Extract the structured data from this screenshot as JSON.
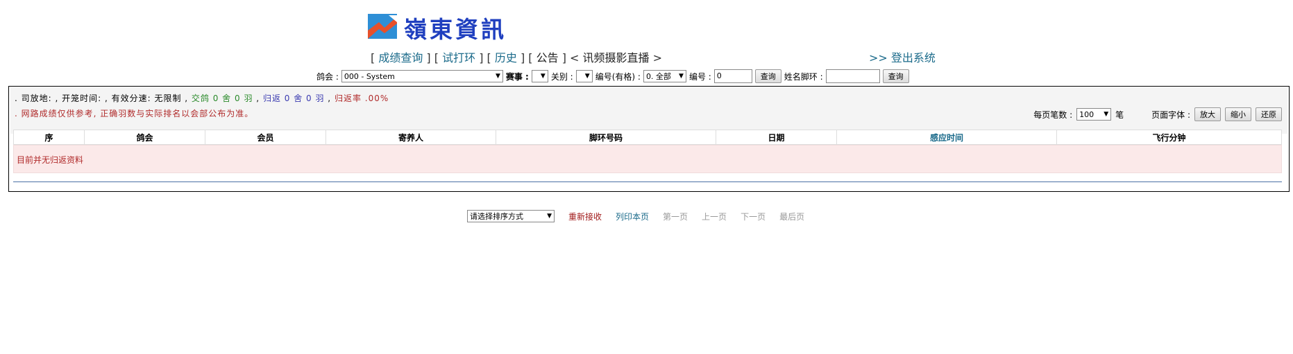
{
  "header": {
    "logo_text": "嶺東資訊"
  },
  "nav": {
    "items": [
      "成绩查询",
      "试打环",
      "历史",
      "公告",
      "讯频摄影直播"
    ],
    "logout_prefix": ">>",
    "logout": "登出系统"
  },
  "filters": {
    "club_label": "鸽会 :",
    "club_value": "000 - System",
    "race_label": "赛事 :",
    "race_value": "",
    "gate_label": "关别 :",
    "gate_value": "",
    "code_label": "编号(有格) :",
    "code_value": "0. 全部",
    "num_label": "编号 :",
    "num_value": "0",
    "query1": "查询",
    "name_label": "姓名脚环 :",
    "name_value": "",
    "query2": "查询"
  },
  "status": {
    "prefix": ". 司放地: , 开笼时间: , 有效分速: 无限制 ,",
    "delivered": "交鸽 0 舍 0 羽",
    "returned": "归返 0 舍 0 羽",
    "rate": "归返率 .00%",
    "sep": ",",
    "notice": ". 网路成绩仅供参考, 正确羽数与实际排名以会部公布为准。"
  },
  "page_controls": {
    "per_page_label": "每页笔数 :",
    "per_page_value": "100",
    "unit": "笔",
    "font_label": "页面字体 :",
    "enlarge": "放大",
    "shrink": "缩小",
    "reset": "还原"
  },
  "table": {
    "headers": [
      "序",
      "鸽会",
      "会员",
      "寄养人",
      "脚环号码",
      "日期",
      "感应时间",
      "飞行分钟"
    ],
    "empty_text": "目前并无归返资料"
  },
  "bottom": {
    "sort_placeholder": "请选择排序方式",
    "reload": "重新接收",
    "print": "列印本页",
    "first": "第一页",
    "prev": "上一页",
    "next": "下一页",
    "last": "最后页"
  },
  "colors": {
    "accent": "#1a6a8a",
    "alert": "#b02a2a",
    "logo": "#1f3fbf"
  }
}
